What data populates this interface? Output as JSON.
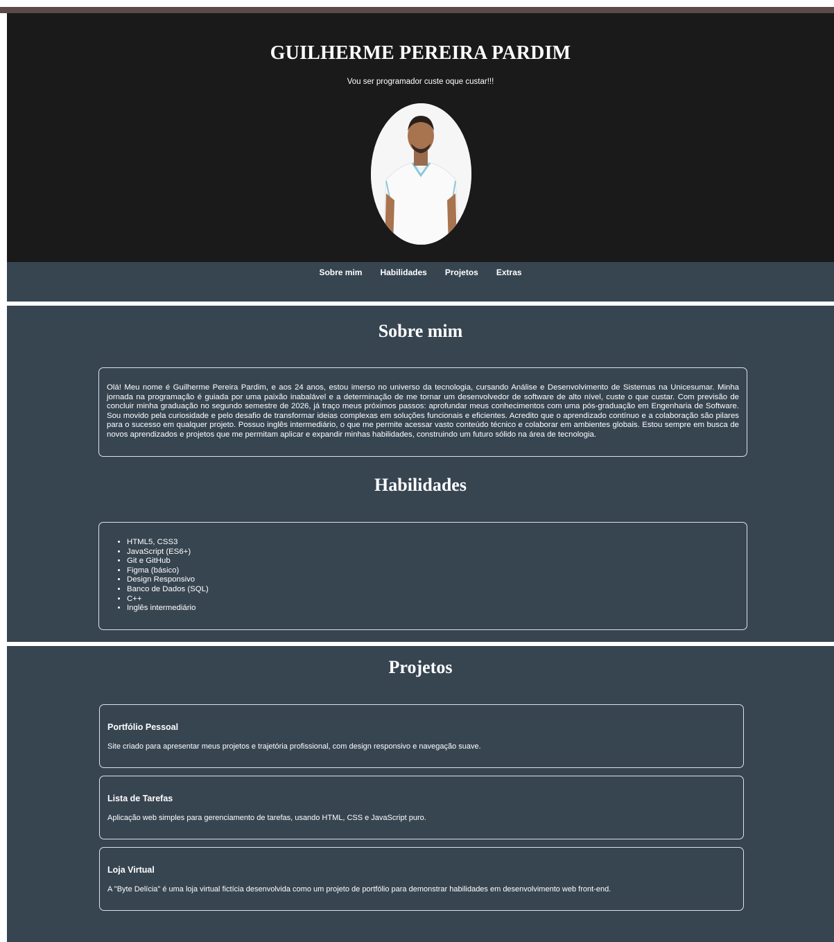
{
  "header": {
    "title": "GUILHERME PEREIRA PARDIM",
    "tagline": "Vou ser programador custe oque custar!!!"
  },
  "nav": {
    "items": [
      {
        "label": "Sobre mim"
      },
      {
        "label": "Habilidades"
      },
      {
        "label": "Projetos"
      },
      {
        "label": "Extras"
      }
    ]
  },
  "about": {
    "heading": "Sobre mim",
    "text": "Olá! Meu nome é Guilherme Pereira Pardim, e aos 24 anos, estou imerso no universo da tecnologia, cursando Análise e Desenvolvimento de Sistemas na Unicesumar. Minha jornada na programação é guiada por uma paixão inabalável e a determinação de me tornar um desenvolvedor de software de alto nível, custe o que custar. Com previsão de concluir minha graduação no segundo semestre de 2026, já traço meus próximos passos: aprofundar meus conhecimentos com uma pós-graduação em Engenharia de Software. Sou movido pela curiosidade e pelo desafio de transformar ideias complexas em soluções funcionais e eficientes. Acredito que o aprendizado contínuo e a colaboração são pilares para o sucesso em qualquer projeto. Possuo inglês intermediário, o que me permite acessar vasto conteúdo técnico e colaborar em ambientes globais. Estou sempre em busca de novos aprendizados e projetos que me permitam aplicar e expandir minhas habilidades, construindo um futuro sólido na área de tecnologia."
  },
  "skills": {
    "heading": "Habilidades",
    "items": [
      "HTML5, CSS3",
      "JavaScript (ES6+)",
      "Git e GitHub",
      "Figma (básico)",
      "Design Responsivo",
      "Banco de Dados (SQL)",
      "C++",
      "Inglês intermediário"
    ]
  },
  "projects": {
    "heading": "Projetos",
    "items": [
      {
        "title": "Portfólio Pessoal",
        "description": "Site criado para apresentar meus projetos e trajetória profissional, com design responsivo e navegação suave."
      },
      {
        "title": "Lista de Tarefas",
        "description": "Aplicação web simples para gerenciamento de tarefas, usando HTML, CSS e JavaScript puro."
      },
      {
        "title": "Loja Virtual",
        "description": "A \"Byte Delícia\" é uma loja virtual fictícia desenvolvida como um projeto de portfólio para demonstrar habilidades em desenvolvimento web front-end."
      }
    ]
  },
  "colors": {
    "header_bg": "#1a1a1a",
    "section_bg": "#374551",
    "text": "#ffffff"
  }
}
